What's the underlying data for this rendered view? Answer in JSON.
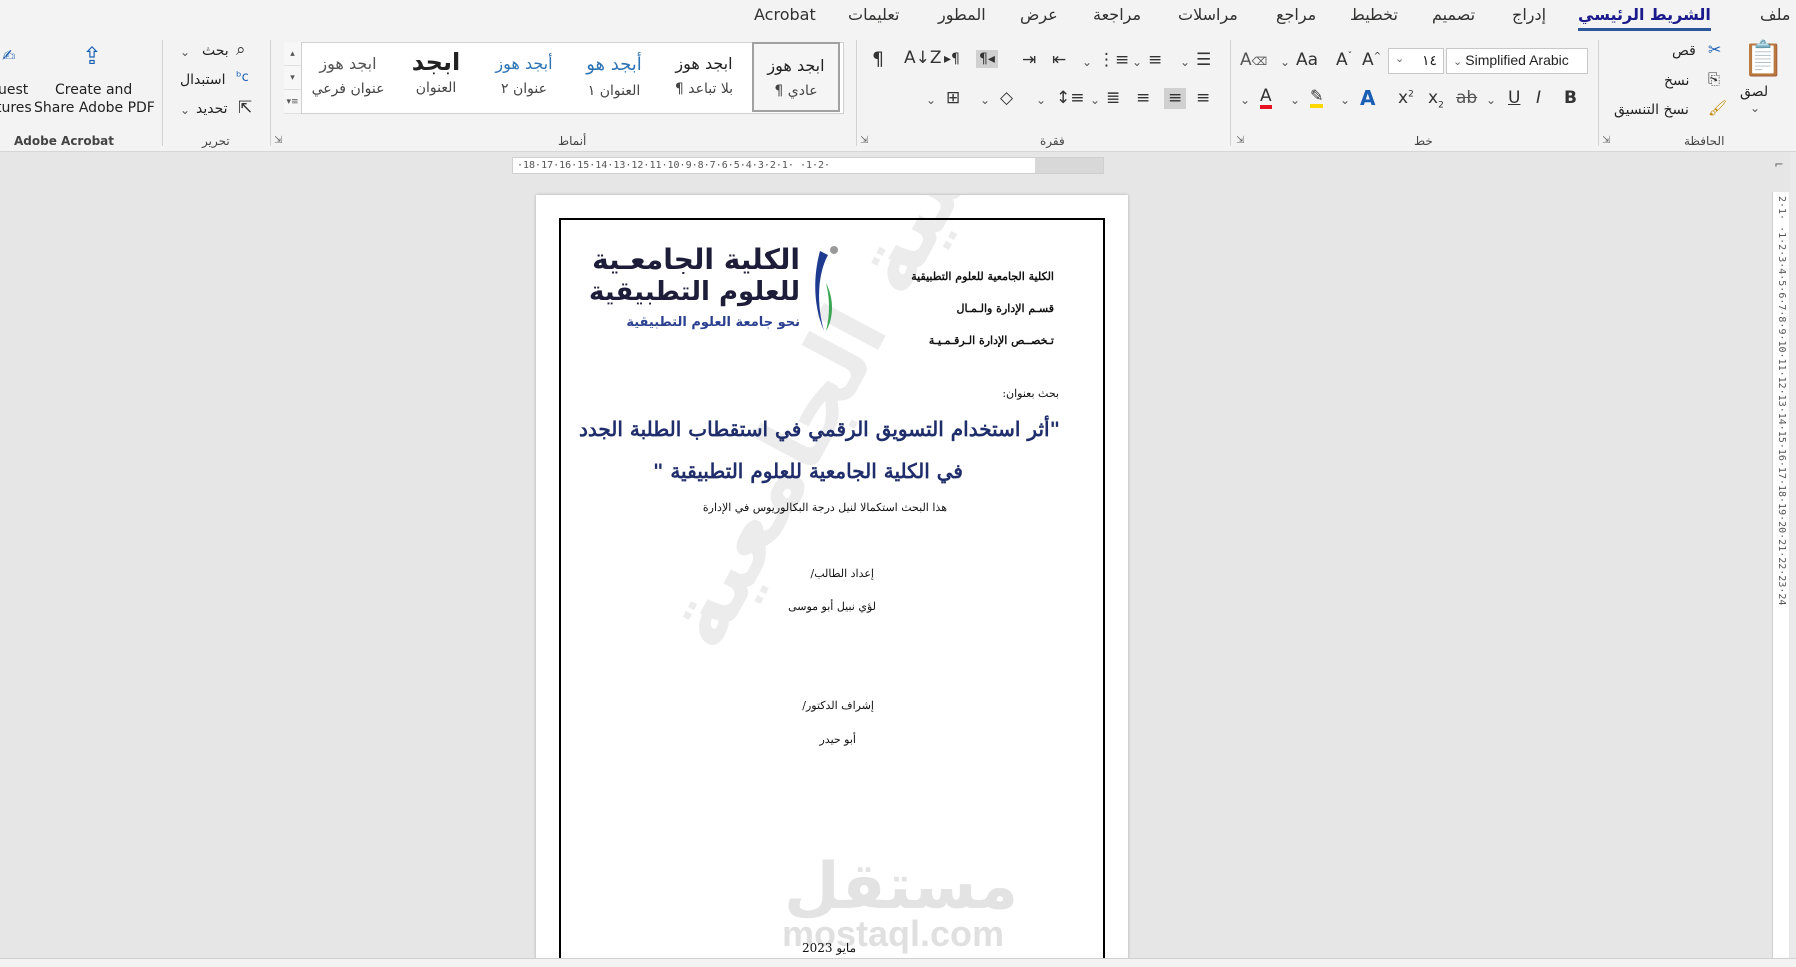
{
  "tabs": [
    "ملف",
    "الشريط الرئيسي",
    "إدراج",
    "تصميم",
    "تخطيط",
    "مراجع",
    "مراسلات",
    "مراجعة",
    "عرض",
    "المطور",
    "تعليمات",
    "Acrobat"
  ],
  "ribbon": {
    "clipboard": {
      "paste": "لصق",
      "cut": "قص",
      "copy": "نسخ",
      "format_painter": "نسخ التنسيق",
      "label": "الحافظة"
    },
    "font": {
      "name": "Simplified Arabic",
      "size": "١٤",
      "label": "خط"
    },
    "paragraph": {
      "label": "فقرة"
    },
    "styles": {
      "label": "أنماط",
      "items": [
        {
          "sample": "ابجد هوز",
          "name": "¶ عادي"
        },
        {
          "sample": "ابجد هوز",
          "name": "¶ بلا تباعد"
        },
        {
          "sample": "أبجد هو",
          "name": "العنوان ١"
        },
        {
          "sample": "أبجد هوز",
          "name": "عنوان ٢"
        },
        {
          "sample": "ابجد",
          "name": "العنوان"
        },
        {
          "sample": "ابجد هوز",
          "name": "عنوان فرعي"
        }
      ]
    },
    "editing": {
      "find": "بحث",
      "replace": "استبدال",
      "select": "تحديد",
      "label": "تحرير"
    },
    "acrobat": {
      "create": "Create and",
      "share": "Share Adobe PDF",
      "partial1": "uest",
      "partial2": "tures",
      "label": "Adobe Acrobat"
    }
  },
  "ruler": {
    "horizontal": "·18·17·16·15·14·13·12·11·10·9·8·7·6·5·4·3·2·1·  ·1·2·",
    "vertical": "2·1· ·1·2·3·4·5·6·7·8·9·10·11·12·13·14·15·16·17·18·19·20·21·22·23·24"
  },
  "document": {
    "institution": "الكلية الجامعية للعلوم التطبيقية",
    "department": "قسـم   الإدارة   والـمـال",
    "specialization": "تـخصــص الإدارة الـرقـمـيـة",
    "logo": {
      "line1": "الكلية الجامعـية",
      "line2": "للعلوم التطبيقية",
      "line3": "نحو جامعة العلوم التطبيقية"
    },
    "research_label": "بحث بعنوان:",
    "title_line1": "\"أثر استخدام التسويق الرقمي في استقطاب الطلبة الجدد",
    "title_line2": "في الكلية الجامعية للعلوم التطبيقية \"",
    "subtitle": "هذا البحث استكمالا لنيل درجة البكالوريوس في الإدارة",
    "prepared_label": "إعداد الطالب/",
    "student": "لؤي نبيل أبو موسى",
    "supervisor_label": "إشراف الدكتور/",
    "supervisor": "أبو حيدر",
    "date": "مايو 2023",
    "watermark": "الكلية الجامعية",
    "mostaql_ar": "مستقل",
    "mostaql_en": "mostaql.com"
  },
  "colors": {
    "accent": "#2b579a",
    "title": "#1f2d6b",
    "font_color_bar": "#e81123",
    "highlight_bar": "#ffd800"
  }
}
